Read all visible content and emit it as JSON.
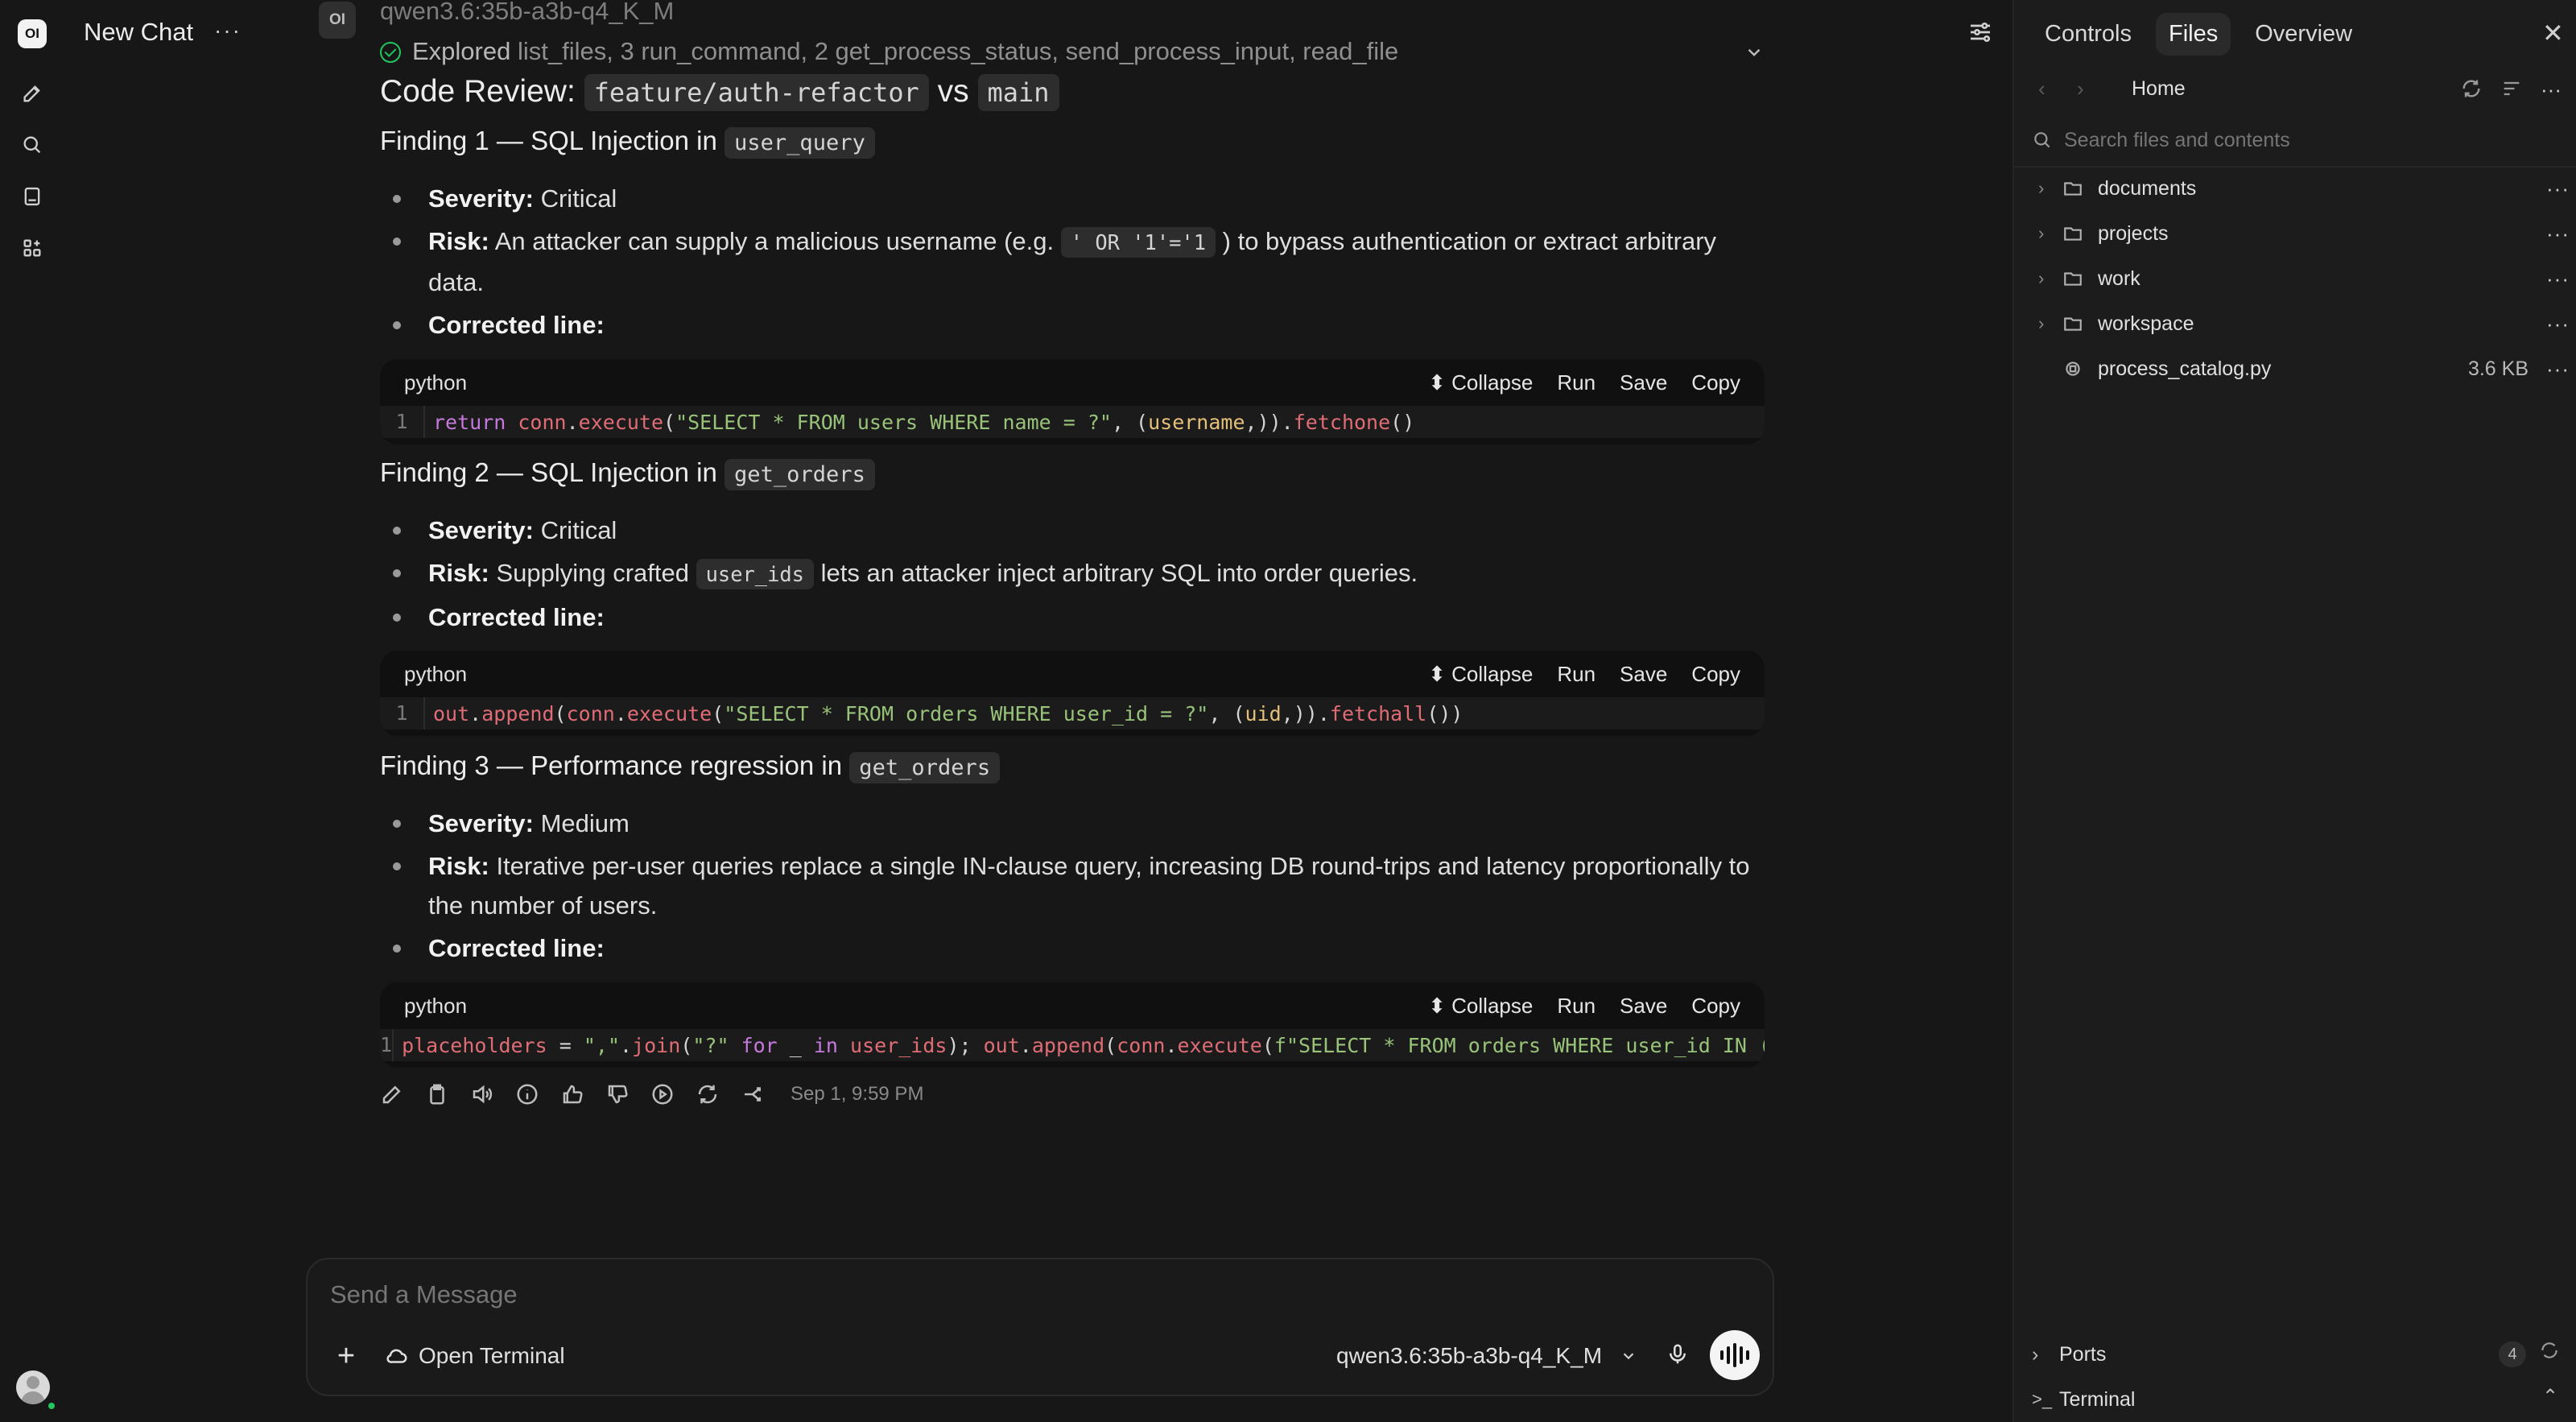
{
  "app": {
    "logo_text": "OI",
    "chat_title": "New Chat",
    "menu_glyph": "···"
  },
  "colors": {
    "background": "#171717",
    "panel": "#1c1c1c",
    "accent_green": "#22c55e",
    "code_bg": "#101010"
  },
  "rail": {
    "icons": [
      "new-chat-pencil-icon",
      "search-icon",
      "notes-icon",
      "workspace-grid-icon"
    ]
  },
  "message": {
    "model_avatar": "OI",
    "model_name": "qwen3.6:35b-a3b-q4_K_M",
    "explored_lead": "Explored",
    "explored_detail": "list_files, 3 run_command, 2 get_process_status, send_process_input, read_file",
    "heading": {
      "prefix": "Code Review:",
      "branch": "feature/auth-refactor",
      "vs": "vs",
      "base": "main"
    },
    "findings": [
      {
        "title": "Finding 1 — SQL Injection in",
        "symbol": "user_query",
        "severity_label": "Severity:",
        "severity": "Critical",
        "risk_label": "Risk:",
        "risk_pre": "An attacker can supply a malicious username (e.g.",
        "risk_code": "' OR '1'='1",
        "risk_post": ") to bypass authentication or extract arbitrary data.",
        "corrected_label": "Corrected line:",
        "code": {
          "lang": "python",
          "line_no": "1"
        }
      },
      {
        "title": "Finding 2 — SQL Injection in",
        "symbol": "get_orders",
        "severity_label": "Severity:",
        "severity": "Critical",
        "risk_label": "Risk:",
        "risk_pre": "Supplying crafted",
        "risk_code": "user_ids",
        "risk_post": "lets an attacker inject arbitrary SQL into order queries.",
        "corrected_label": "Corrected line:",
        "code": {
          "lang": "python",
          "line_no": "1"
        }
      },
      {
        "title": "Finding 3 — Performance regression in",
        "symbol": "get_orders",
        "severity_label": "Severity:",
        "severity": "Medium",
        "risk_label": "Risk:",
        "risk_text": "Iterative per-user queries replace a single IN-clause query, increasing DB round-trips and latency proportionally to the number of users.",
        "corrected_label": "Corrected line:",
        "code": {
          "lang": "python",
          "line_no": "1"
        }
      }
    ],
    "code_actions": {
      "collapse": "Collapse",
      "run": "Run",
      "save": "Save",
      "copy": "Copy"
    },
    "timestamp": "Sep 1, 9:59 PM"
  },
  "composer": {
    "placeholder": "Send a Message",
    "attach": "+",
    "open_terminal": "Open Terminal",
    "model": "qwen3.6:35b-a3b-q4_K_M"
  },
  "panel": {
    "tabs": [
      "Controls",
      "Files",
      "Overview"
    ],
    "active_tab": "Files",
    "close": "✕",
    "path_home": "Home",
    "search_placeholder": "Search files and contents",
    "items": [
      {
        "name": "documents",
        "type": "folder"
      },
      {
        "name": "projects",
        "type": "folder"
      },
      {
        "name": "work",
        "type": "folder"
      },
      {
        "name": "workspace",
        "type": "folder"
      },
      {
        "name": "process_catalog.py",
        "type": "file",
        "size": "3.6 KB"
      }
    ],
    "more_glyph": "···",
    "ports_label": "Ports",
    "ports_count": "4",
    "terminal_label": "Terminal"
  }
}
